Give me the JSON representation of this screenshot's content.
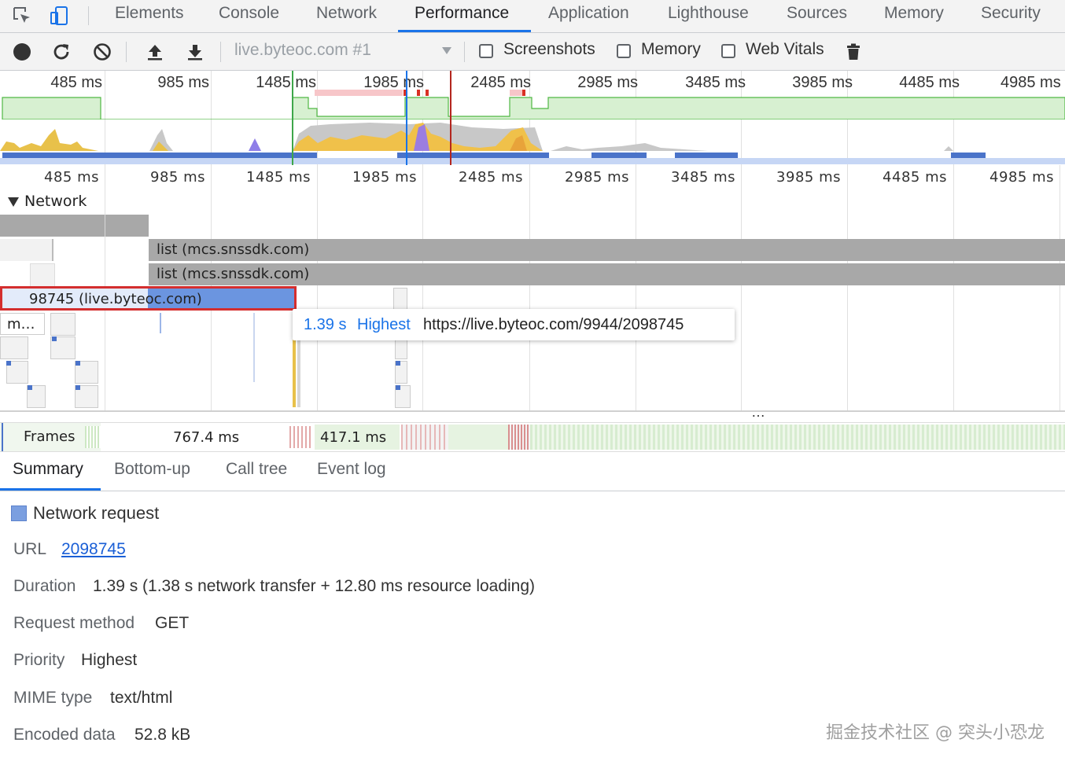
{
  "tabbar": {
    "tabs": [
      {
        "label": "Elements"
      },
      {
        "label": "Console"
      },
      {
        "label": "Network"
      },
      {
        "label": "Performance"
      },
      {
        "label": "Application"
      },
      {
        "label": "Lighthouse"
      },
      {
        "label": "Sources"
      },
      {
        "label": "Memory"
      },
      {
        "label": "Security"
      }
    ],
    "active_tab": "Performance",
    "accent_color": "#1a73e8",
    "icons": [
      "inspect-element-icon",
      "device-toolbar-icon"
    ]
  },
  "toolbar": {
    "profile_select": "live.byteoc.com #1",
    "checkboxes": [
      {
        "label": "Screenshots",
        "checked": false
      },
      {
        "label": "Memory",
        "checked": false
      },
      {
        "label": "Web Vitals",
        "checked": false
      }
    ],
    "icons": [
      "record-icon",
      "reload-icon",
      "clear-icon",
      "upload-icon",
      "download-icon",
      "trash-icon"
    ]
  },
  "overview": {
    "ticks": [
      "485 ms",
      "985 ms",
      "1485 ms",
      "1985 ms",
      "2485 ms",
      "2985 ms",
      "3485 ms",
      "3985 ms",
      "4485 ms",
      "4985 ms"
    ]
  },
  "timeline": {
    "ticks": [
      "485 ms",
      "985 ms",
      "1485 ms",
      "1985 ms",
      "2485 ms",
      "2985 ms",
      "3485 ms",
      "3985 ms",
      "4485 ms",
      "4985 ms"
    ],
    "network_track": "Network",
    "requests": [
      {
        "label": "list (mcs.snssdk.com)"
      },
      {
        "label": "list (mcs.snssdk.com)"
      },
      {
        "label": "98745 (live.byteoc.com)"
      },
      {
        "label": "m…"
      }
    ],
    "tooltip": {
      "time": "1.39 s",
      "priority": "Highest",
      "url": "https://live.byteoc.com/9944/2098745"
    },
    "frames": {
      "label": "Frames",
      "value1": "767.4 ms",
      "value2": "417.1 ms"
    },
    "more": "…"
  },
  "summary": {
    "tabs": [
      {
        "label": "Summary"
      },
      {
        "label": "Bottom-up"
      },
      {
        "label": "Call tree"
      },
      {
        "label": "Event log"
      }
    ],
    "active_tab": "Summary",
    "title": "Network request",
    "swatch_color": "#7b9fe0",
    "fields": {
      "url_label": "URL",
      "url_value": "2098745",
      "duration_label": "Duration",
      "duration_value": "1.39 s (1.38 s network transfer + 12.80 ms resource loading)",
      "method_label": "Request method",
      "method_value": "GET",
      "priority_label": "Priority",
      "priority_value": "Highest",
      "mime_label": "MIME type",
      "mime_value": "text/html",
      "encoded_label": "Encoded data",
      "encoded_value": "52.8 kB"
    }
  },
  "watermark": "掘金技术社区 @ 突头小恐龙"
}
